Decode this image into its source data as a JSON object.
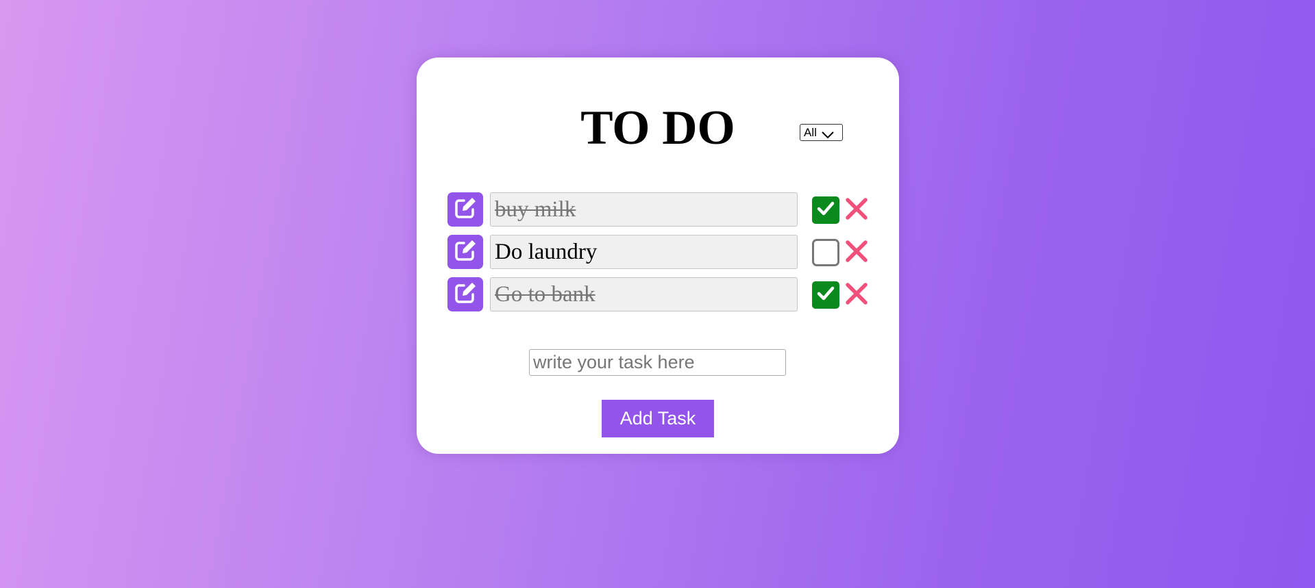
{
  "header": {
    "title": "TO DO",
    "filter_selected": "All"
  },
  "tasks": [
    {
      "text": "buy milk",
      "completed": true
    },
    {
      "text": "Do laundry",
      "completed": false
    },
    {
      "text": "Go to bank",
      "completed": true
    }
  ],
  "new_task": {
    "value": "",
    "placeholder": "write your task here"
  },
  "add_button_label": "Add Task",
  "icons": {
    "edit": "edit-icon",
    "check": "checkmark-icon",
    "delete": "cross-icon",
    "dropdown": "chevron-down-icon"
  },
  "colors": {
    "accent": "#9354ea",
    "check_on": "#0a8a1c",
    "delete": "#f0507a"
  }
}
